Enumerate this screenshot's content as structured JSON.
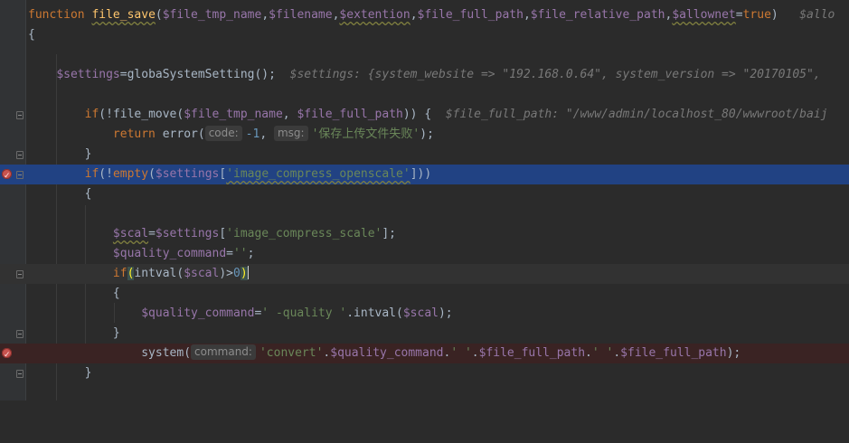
{
  "lines": {
    "l1": {
      "kw": "function",
      "name": "file_save",
      "open": "(",
      "p1": "$file_tmp_name",
      "c1": ",",
      "p2": "$filename",
      "c2": ",",
      "p3": "$extention",
      "c3": ",",
      "p4": "$file_full_path",
      "c4": ",",
      "p5": "$file_relative_path",
      "c5": ",",
      "p6": "$allownet",
      "eq": "=",
      "def": "true",
      "close": ")",
      "hint": "$allo"
    },
    "l2": {
      "brace": "{"
    },
    "l4": {
      "var": "$settings",
      "eq": "=",
      "call": "globaSystemSetting",
      "tail": "();",
      "hint": "$settings: {system_website => \"192.168.0.64\", system_version => \"20170105\","
    },
    "l6": {
      "kw": "if",
      "pre": "(!",
      "call": "file_move",
      "open": "(",
      "a1": "$file_tmp_name",
      "comma": ", ",
      "a2": "$file_full_path",
      "tail": ")) {",
      "hint": "$file_full_path: \"/www/admin/localhost_80/wwwroot/baij"
    },
    "l7": {
      "kw": "return",
      "call": "error",
      "open": "(",
      "param1": "code:",
      "num": "-1",
      "comma": ", ",
      "param2": "msg:",
      "str": "'保存上传文件失败'",
      "tail": ");"
    },
    "l8": {
      "brace": "}"
    },
    "l9": {
      "kw": "if",
      "pre": "(!",
      "call": "empty",
      "open": "(",
      "var": "$settings",
      "lb": "[",
      "str": "'image_compress_openscale'",
      "tail": "]))"
    },
    "l10": {
      "brace": "{"
    },
    "l12": {
      "var": "$scal",
      "eq": "=",
      "var2": "$settings",
      "lb": "[",
      "str": "'image_compress_scale'",
      "tail": "];"
    },
    "l13": {
      "var": "$quality_command",
      "eq": "=",
      "str": "''",
      "tail": ";"
    },
    "l14": {
      "kw": "if",
      "open": "(",
      "call": "intval",
      "open2": "(",
      "var": "$scal",
      "mid": ")>",
      "num": "0",
      "close": ")"
    },
    "l15": {
      "brace": "{"
    },
    "l16": {
      "var": "$quality_command",
      "eq": "=",
      "str": "' -quality '",
      "dot": ".",
      "call": "intval",
      "open": "(",
      "var2": "$scal",
      "tail": ");"
    },
    "l17": {
      "brace": "}"
    },
    "l18": {
      "call": "system",
      "open": "(",
      "param": "command:",
      "s1": "'convert'",
      "d1": ".",
      "v1": "$quality_command",
      "d2": ".",
      "s2": "' '",
      "d3": ".",
      "v2": "$file_full_path",
      "d4": ".",
      "s3": "' '",
      "d5": ".",
      "v3": "$file_full_path",
      "tail": ");"
    },
    "l19": {
      "brace": "}"
    }
  },
  "colors": {
    "background": "#2b2b2b",
    "keyword": "#cc7832",
    "function": "#ffc66d",
    "variable": "#9876aa",
    "string": "#6a8759",
    "number": "#6897bb",
    "selection": "#214283",
    "breakpoint": "#c75450"
  },
  "icons": [
    "fold-marker-icon",
    "breakpoint-icon"
  ]
}
